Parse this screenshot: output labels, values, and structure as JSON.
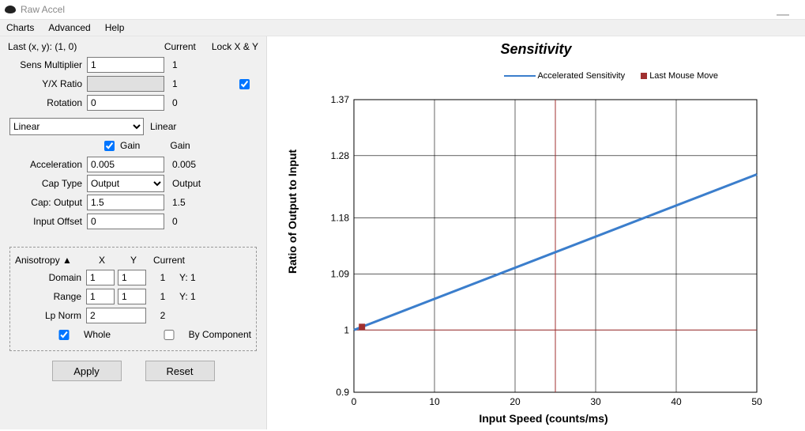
{
  "app_title": "Raw Accel",
  "menubar": {
    "charts": "Charts",
    "advanced": "Advanced",
    "help": "Help"
  },
  "header": {
    "last": "Last (x, y): (1, 0)",
    "current": "Current",
    "lockxy": "Lock X & Y"
  },
  "fields": {
    "sens_label": "Sens Multiplier",
    "sens_val": "1",
    "sens_cur": "1",
    "yx_label": "Y/X Ratio",
    "yx_val": "",
    "yx_cur": "1",
    "rot_label": "Rotation",
    "rot_val": "0",
    "rot_cur": "0",
    "mode": "Linear",
    "mode_cur": "Linear",
    "gain_label": "Gain",
    "gain_cur": "Gain",
    "accel_label": "Acceleration",
    "accel_val": "0.005",
    "accel_cur": "0.005",
    "captype_label": "Cap Type",
    "captype_val": "Output",
    "captype_cur": "Output",
    "capout_label": "Cap: Output",
    "capout_val": "1.5",
    "capout_cur": "1.5",
    "offset_label": "Input Offset",
    "offset_val": "0",
    "offset_cur": "0"
  },
  "aniso": {
    "title": "Anisotropy ▲",
    "x": "X",
    "y": "Y",
    "current": "Current",
    "domain_label": "Domain",
    "domain_x": "1",
    "domain_y": "1",
    "domain_cur": "1",
    "domain_ycur": "Y: 1",
    "range_label": "Range",
    "range_x": "1",
    "range_y": "1",
    "range_cur": "1",
    "range_ycur": "Y: 1",
    "lp_label": "Lp Norm",
    "lp_val": "2",
    "lp_cur": "2",
    "whole": "Whole",
    "bycomp": "By Component"
  },
  "buttons": {
    "apply": "Apply",
    "reset": "Reset"
  },
  "chart_data": {
    "type": "line",
    "title": "Sensitivity",
    "xlabel": "Input Speed (counts/ms)",
    "ylabel": "Ratio of Output to Input",
    "xlim": [
      0,
      50
    ],
    "ylim": [
      0.9,
      1.37
    ],
    "xticks": [
      0,
      10,
      20,
      30,
      40,
      50
    ],
    "yticks": [
      0.9,
      1,
      1.09,
      1.18,
      1.28,
      1.37
    ],
    "series": [
      {
        "name": "Accelerated Sensitivity",
        "color": "#3b7ecc",
        "x": [
          0,
          50
        ],
        "y": [
          1.0,
          1.25
        ]
      }
    ],
    "marker": {
      "name": "Last Mouse Move",
      "color": "#a03030",
      "x": 1,
      "y": 1.005,
      "guide_x": 25,
      "guide_y": 1.0
    },
    "legend": {
      "series": "Accelerated Sensitivity",
      "marker": "Last Mouse Move"
    }
  }
}
